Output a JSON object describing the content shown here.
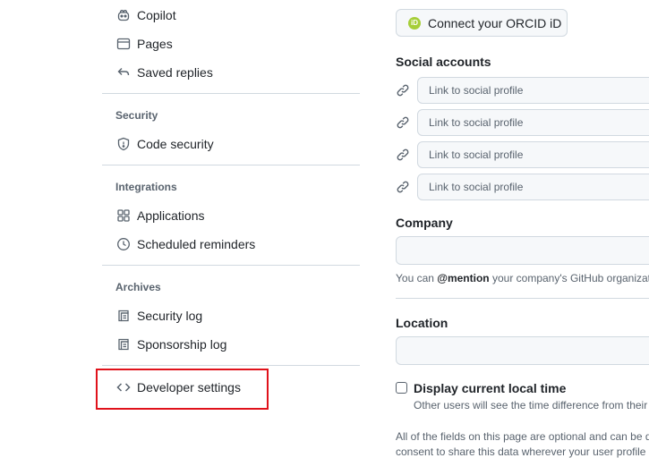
{
  "sidebar": {
    "items_top": [
      {
        "label": "Copilot",
        "icon": "copilot-icon"
      },
      {
        "label": "Pages",
        "icon": "browser-icon"
      },
      {
        "label": "Saved replies",
        "icon": "reply-icon"
      }
    ],
    "security": {
      "title": "Security",
      "items": [
        {
          "label": "Code security",
          "icon": "shield-icon"
        }
      ]
    },
    "integrations": {
      "title": "Integrations",
      "items": [
        {
          "label": "Applications",
          "icon": "apps-icon"
        },
        {
          "label": "Scheduled reminders",
          "icon": "clock-icon"
        }
      ]
    },
    "archives": {
      "title": "Archives",
      "items": [
        {
          "label": "Security log",
          "icon": "log-icon"
        },
        {
          "label": "Sponsorship log",
          "icon": "log-icon"
        }
      ]
    },
    "developer_settings": {
      "label": "Developer settings",
      "icon": "code-icon"
    }
  },
  "main": {
    "orcid_button": {
      "badge": "iD",
      "label": "Connect your ORCID iD"
    },
    "social": {
      "heading": "Social accounts",
      "placeholder": "Link to social profile"
    },
    "company": {
      "heading": "Company",
      "note_prefix": "You can ",
      "note_mention": "@mention",
      "note_suffix": " your company's GitHub organizati"
    },
    "location": {
      "heading": "Location"
    },
    "local_time": {
      "label": "Display current local time",
      "description": "Other users will see the time difference from their"
    },
    "footer": {
      "line1": "All of the fields on this page are optional and can be d",
      "line2": "consent to share this data wherever your user profile a"
    }
  },
  "colors": {
    "highlight": "#e0121b",
    "orcid": "#a6ce39"
  }
}
